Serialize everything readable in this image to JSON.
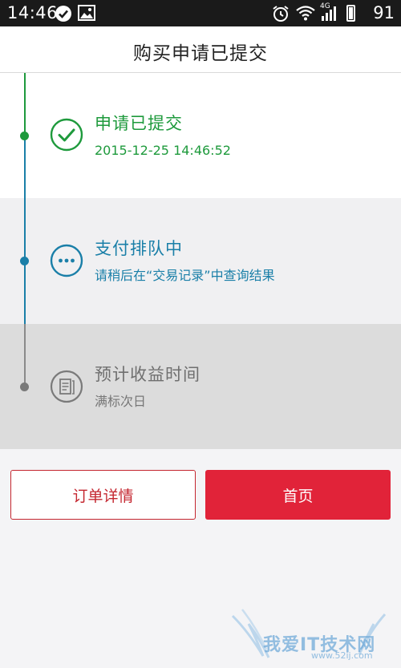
{
  "status_bar": {
    "time": "14:46",
    "network": "4G",
    "battery": "91",
    "left_icons": [
      "check-circle-icon",
      "image-icon"
    ],
    "right_icons": [
      "alarm-icon",
      "wifi-icon",
      "signal-icon"
    ]
  },
  "header": {
    "title": "购买申请已提交"
  },
  "steps": [
    {
      "title": "申请已提交",
      "subtitle": "2015-12-25 14:46:52",
      "icon": "check-circle-icon",
      "color": "#1e9a3c"
    },
    {
      "title": "支付排队中",
      "subtitle": "请稍后在“交易记录”中查询结果",
      "icon": "more-dots-icon",
      "color": "#1a7fa8"
    },
    {
      "title": "预计收益时间",
      "subtitle": "满标次日",
      "icon": "document-icon",
      "color": "#7a7a7a"
    }
  ],
  "buttons": {
    "order_details": "订单详情",
    "home": "首页"
  },
  "watermark": {
    "text": "我爱IT技术网",
    "url": "www.52ij.com"
  },
  "colors": {
    "accent_red": "#e12339",
    "success_green": "#1e9a3c",
    "pending_blue": "#1a7fa8",
    "inactive_gray": "#7a7a7a"
  }
}
